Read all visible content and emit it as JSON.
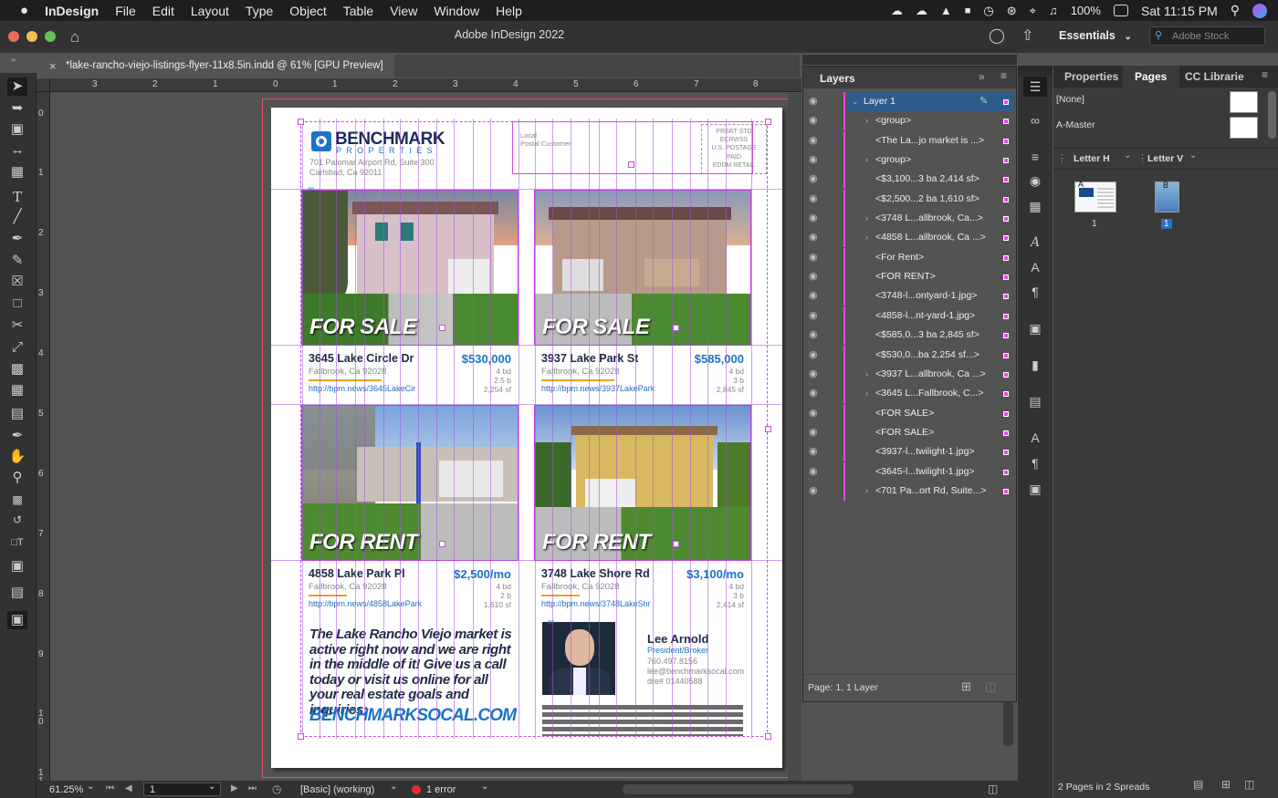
{
  "menubar": {
    "apple": "",
    "app_name": "InDesign",
    "items": [
      "File",
      "Edit",
      "Layout",
      "Type",
      "Object",
      "Table",
      "View",
      "Window",
      "Help"
    ],
    "battery": "100%",
    "clock": "Sat 11:15 PM"
  },
  "appbar": {
    "title": "Adobe InDesign 2022",
    "workspace": "Essentials",
    "stock_placeholder": "Adobe Stock"
  },
  "document_tab": {
    "close": "×",
    "title": "*lake-rancho-viejo-listings-flyer-11x8.5in.indd @ 61% [GPU Preview]"
  },
  "rulers": {
    "h": [
      "3",
      "2",
      "1",
      "0",
      "1",
      "2",
      "3",
      "4",
      "5",
      "6",
      "7",
      "8"
    ],
    "v": [
      "0",
      "1",
      "2",
      "3",
      "4",
      "5",
      "6",
      "7",
      "8",
      "9",
      "1\n0",
      "1\n1"
    ]
  },
  "flyer": {
    "logo_name": "BENCHMARK",
    "logo_sub": "PROPERTIES",
    "address_line1": "701 Palomar Airport Rd, Suite 300",
    "address_line2": "Carlsbad, Ca 92011",
    "mail_local": "Local",
    "mail_customer": "Postal Customer",
    "postage": "PRSRT STD\nECRWSS\nU.S. POSTAGE\nPAID\nEDDM RETAIL",
    "listings": [
      {
        "banner": "FOR SALE",
        "street": "3645 Lake Circle Dr",
        "price": "$530,000",
        "city": "Fallbrook, Ca 92028",
        "url": "http://bpm.news/3645LakeCir",
        "specs": "4 bd\n2.5 b\n2,254 sf"
      },
      {
        "banner": "FOR SALE",
        "street": "3937 Lake Park St",
        "price": "$585,000",
        "city": "Fallbrook, Ca 92028",
        "url": "http://bpm.news/3937LakePark",
        "specs": "4 bd\n3 b\n2,845 sf"
      },
      {
        "banner": "FOR RENT",
        "street": "4858 Lake Park Pl",
        "price": "$2,500/mo",
        "city": "Fallbrook, Ca 92028",
        "url": "http://bpm.news/4858LakePark",
        "specs": "4 bd\n2 b\n1,610 sf"
      },
      {
        "banner": "FOR RENT",
        "street": "3748 Lake Shore Rd",
        "price": "$3,100/mo",
        "city": "Fallbrook, Ca 92028",
        "url": "http://bpm.news/3748LakeShr",
        "specs": "4 bd\n3 b\n2,414 sf"
      }
    ],
    "promo": "The Lake Rancho Viejo market is active right now and we are right in the middle of it! Give us a call today or visit us online for all your real estate goals and inquiries:",
    "promo_url": "BENCHMARKSOCAL.COM",
    "agent_name": "Lee Arnold",
    "agent_title": "President/Broker",
    "agent_phone": "760.497.8156",
    "agent_email": "lee@benchmarksocal.com",
    "agent_dre": "dre# 01440588"
  },
  "layers_panel": {
    "title": "Layers",
    "layer_name": "Layer 1",
    "rows": [
      {
        "label": "<group>",
        "twisty": true
      },
      {
        "label": "<The La...jo market is ...>",
        "twisty": false
      },
      {
        "label": "<group>",
        "twisty": true
      },
      {
        "label": "<$3,100...3 ba 2,414 sf>",
        "twisty": false
      },
      {
        "label": "<$2,500...2 ba 1,610 sf>",
        "twisty": false
      },
      {
        "label": "<3748 L...allbrook, Ca...>",
        "twisty": true
      },
      {
        "label": "<4858 L...allbrook, Ca ...>",
        "twisty": true
      },
      {
        "label": "<For Rent>",
        "twisty": false
      },
      {
        "label": "<FOR RENT>",
        "twisty": false
      },
      {
        "label": "<3748-l...ontyard-1.jpg>",
        "twisty": false
      },
      {
        "label": "<4858-l...nt-yard-1.jpg>",
        "twisty": false
      },
      {
        "label": "<$585,0...3 ba 2,845 sf>",
        "twisty": false
      },
      {
        "label": "<$530,0...ba 2,254 sf...>",
        "twisty": false
      },
      {
        "label": "<3937 L...allbrook, Ca ...>",
        "twisty": true
      },
      {
        "label": "<3645 L...Fallbrook, C...>",
        "twisty": true
      },
      {
        "label": "<FOR SALE>",
        "twisty": false
      },
      {
        "label": "<FOR SALE>",
        "twisty": false
      },
      {
        "label": "<3937-l...twilight-1.jpg>",
        "twisty": false
      },
      {
        "label": "<3645-l...twilight-1.jpg>",
        "twisty": false
      },
      {
        "label": "<701 Pa...ort Rd, Suite...>",
        "twisty": true
      }
    ],
    "footer": "Page: 1, 1 Layer"
  },
  "pages_panel": {
    "tabs": [
      "Properties",
      "Pages",
      "CC Librarie"
    ],
    "masters": [
      "[None]",
      "A-Master"
    ],
    "size_h": "Letter H",
    "size_v": "Letter V",
    "page_labels": [
      "1",
      "1"
    ],
    "page_badges": [
      "A",
      "B"
    ],
    "footer": "2 Pages in 2 Spreads"
  },
  "status": {
    "zoom": "61.25%",
    "page": "1",
    "style": "[Basic] (working)",
    "errors": "1 error"
  },
  "colors": {
    "accent_blue": "#1a73c8",
    "guide_purple": "#a450dc",
    "frame_magenta": "#c84fd8",
    "navy": "#1e2a44"
  }
}
